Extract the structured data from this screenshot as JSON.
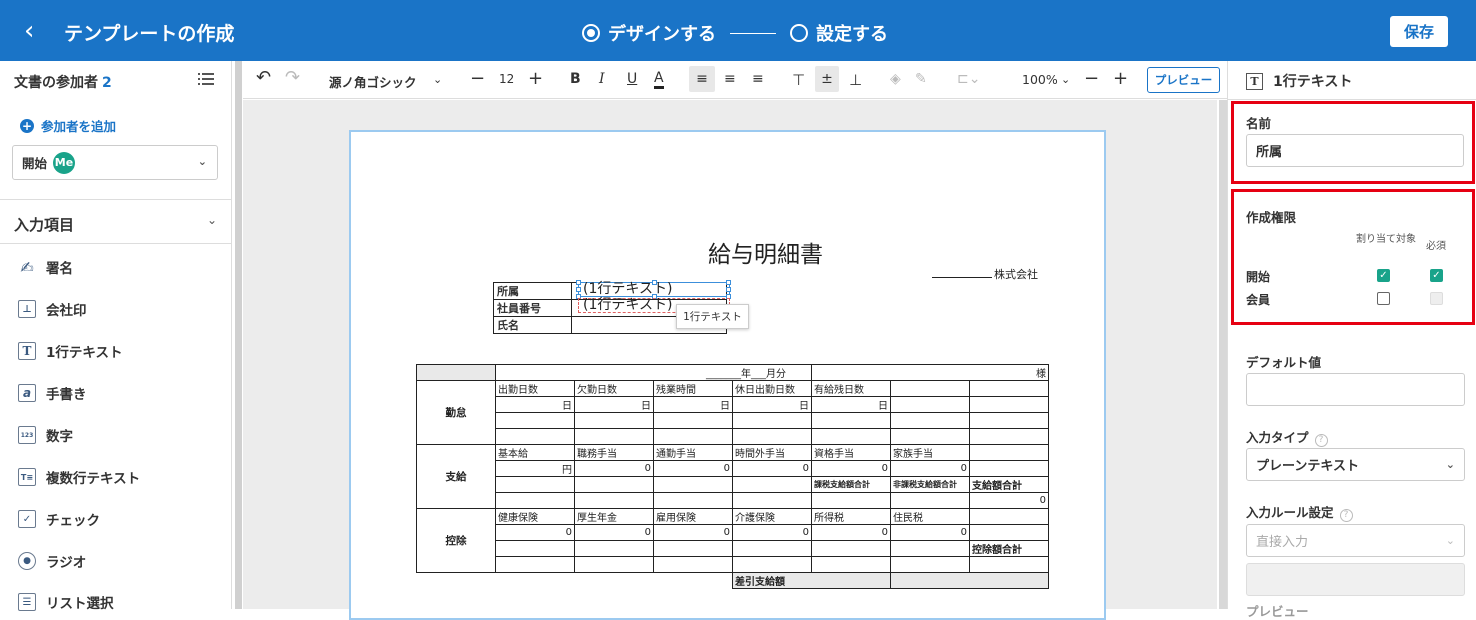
{
  "header": {
    "back_glyph": "‹",
    "title": "テンプレートの作成",
    "step1": "デザインする",
    "step2": "設定する",
    "save_label": "保存",
    "accent": "#1a74c7"
  },
  "left": {
    "participants_label": "文書の参加者",
    "participants_count": "2",
    "add_participant": "参加者を追加",
    "starter_label": "開始",
    "starter_avatar": "Me",
    "input_items_label": "入力項目",
    "items": [
      {
        "label": "署名",
        "icon": "pen-icon",
        "glyph": "✍"
      },
      {
        "label": "会社印",
        "icon": "stamp-icon",
        "glyph": "⊥"
      },
      {
        "label": "1行テキスト",
        "icon": "text-icon",
        "glyph": "T"
      },
      {
        "label": "手書き",
        "icon": "handwriting-icon",
        "glyph": "a"
      },
      {
        "label": "数字",
        "icon": "number-icon",
        "glyph": "123"
      },
      {
        "label": "複数行テキスト",
        "icon": "multiline-text-icon",
        "glyph": "T≡"
      },
      {
        "label": "チェック",
        "icon": "checkbox-icon",
        "glyph": "✓"
      },
      {
        "label": "ラジオ",
        "icon": "radio-icon",
        "glyph": "●"
      },
      {
        "label": "リスト選択",
        "icon": "list-icon",
        "glyph": "☰"
      }
    ]
  },
  "toolbar": {
    "font": "源ノ角ゴシック",
    "size": "12",
    "zoom": "100%",
    "preview": "プレビュー"
  },
  "document": {
    "title": "給与明細書",
    "company": "株式会社",
    "info_rows": [
      "所属",
      "社員番号",
      "氏名"
    ],
    "field1": "(1行テキスト)",
    "field2": "(1行テキスト)",
    "tooltip": "1行テキスト",
    "period": "_______年___月分",
    "sama": "様",
    "attendance_side": "勤怠",
    "attendance_headers": [
      "出勤日数",
      "欠勤日数",
      "残業時間",
      "休日出勤日数",
      "有給残日数",
      ""
    ],
    "attendance_values": [
      "日",
      "日",
      "日",
      "日",
      "日",
      ""
    ],
    "payment_side": "支給",
    "payment_headers": [
      "基本給",
      "職務手当",
      "通勤手当",
      "時間外手当",
      "資格手当",
      "家族手当"
    ],
    "payment_values": [
      "円",
      "0",
      "0",
      "0",
      "0",
      "0"
    ],
    "taxable_total": "課税支給額合計",
    "nontaxable_total": "非課税支給額合計",
    "payment_total": "支給額合計",
    "payment_total_value": "0",
    "deduction_side": "控除",
    "deduction_headers": [
      "健康保険",
      "厚生年金",
      "雇用保険",
      "介護保険",
      "所得税",
      "住民税"
    ],
    "deduction_values": [
      "0",
      "0",
      "0",
      "0",
      "0",
      "0"
    ],
    "deduction_total": "控除額合計",
    "net_pay": "差引支給額"
  },
  "right": {
    "field_type": "1行テキスト",
    "name_label": "名前",
    "name_value": "所属",
    "permission_label": "作成権限",
    "col_assign": "割り当て対象",
    "col_required": "必須",
    "perm_rows": [
      "開始",
      "会員"
    ],
    "default_label": "デフォルト値",
    "default_value": "",
    "input_type_label": "入力タイプ",
    "input_type_value": "プレーンテキスト",
    "rule_label": "入力ルール設定",
    "rule_value": "直接入力",
    "preview_label": "プレビュー"
  }
}
